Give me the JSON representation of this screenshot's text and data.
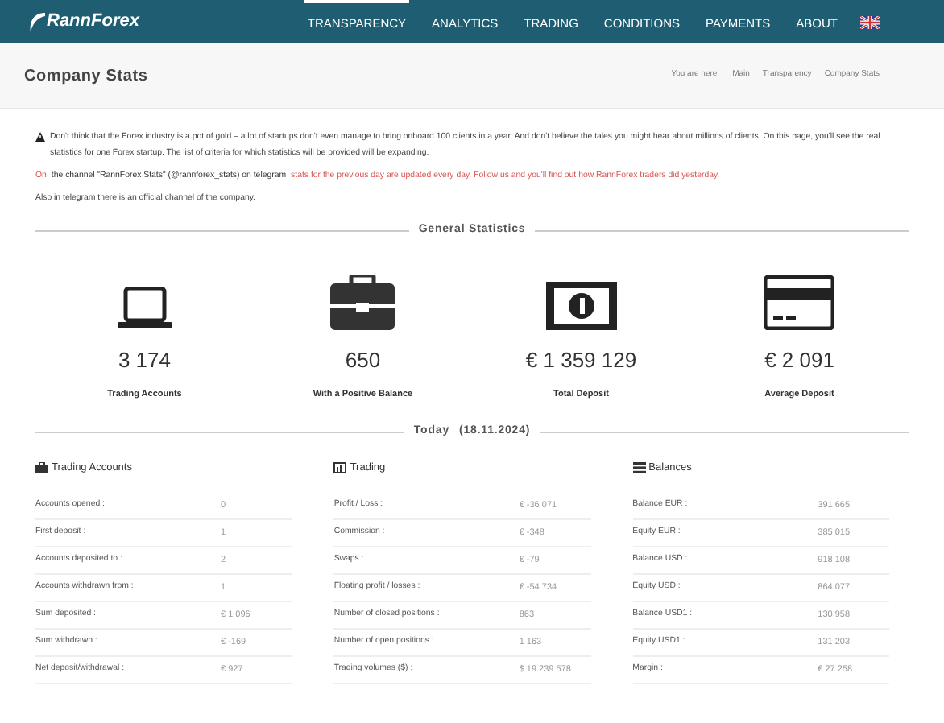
{
  "header": {
    "logo": "RannForex",
    "nav": [
      {
        "label": "TRANSPARENCY",
        "selected": true
      },
      {
        "label": "ANALYTICS",
        "selected": false
      },
      {
        "label": "TRADING",
        "selected": false
      },
      {
        "label": "CONDITIONS",
        "selected": false
      },
      {
        "label": "PAYMENTS",
        "selected": false
      },
      {
        "label": "ABOUT",
        "selected": false
      }
    ]
  },
  "page_title": "Company Stats",
  "breadcrumb": [
    "You are here:",
    "Main",
    "Transparency",
    "Company Stats"
  ],
  "intro": {
    "warning": "Don't think that the Forex industry is a pot of gold – a lot of startups don't even manage to bring onboard 100 clients in a year. And don't believe the tales you might hear about millions of clients. On this page, you'll see the real statistics for one Forex startup. The list of criteria for which statistics will be provided will be expanding.",
    "channel": [
      {
        "text": "On",
        "accent": true
      },
      {
        "text": "the channel \"RannForex Stats\" (@rannforex_stats) on telegram",
        "accent": false
      },
      {
        "text": "stats for the previous day are updated every day. Follow us and you'll find out how RannForex traders did yesterday.",
        "accent": true
      }
    ],
    "official": "Also in telegram there is an official channel of the company."
  },
  "general": {
    "title": "General Statistics",
    "stats": [
      {
        "kind": "laptop",
        "value": "3 174",
        "label": "Trading Accounts"
      },
      {
        "kind": "briefcase",
        "value": "650",
        "label": "With a Positive Balance"
      },
      {
        "kind": "banknote",
        "value": "€ 1 359 129",
        "label": "Total Deposit"
      },
      {
        "kind": "card",
        "value": "€ 2 091",
        "label": "Average Deposit"
      }
    ]
  },
  "today": {
    "title": "Today",
    "date": "(18.11.2024)"
  },
  "tables": [
    {
      "kind": "briefcase",
      "title": "Trading Accounts",
      "rows": [
        {
          "label": "Accounts opened :",
          "value": "0"
        },
        {
          "label": "First deposit :",
          "value": "1"
        },
        {
          "label": "Accounts deposited to :",
          "value": "2"
        },
        {
          "label": "Accounts withdrawn from :",
          "value": "1"
        },
        {
          "label": "Sum deposited :",
          "value": "€ 1 096"
        },
        {
          "label": "Sum withdrawn :",
          "value": "€ -169"
        },
        {
          "label": "Net deposit/withdrawal :",
          "value": "€ 927"
        }
      ]
    },
    {
      "kind": "chart",
      "title": "Trading",
      "rows": [
        {
          "label": "Profit / Loss :",
          "value": "€ -36 071"
        },
        {
          "label": "Commission :",
          "value": "€ -348"
        },
        {
          "label": "Swaps :",
          "value": "€ -79"
        },
        {
          "label": "Floating profit / losses :",
          "value": "€ -54 734"
        },
        {
          "label": "Number of closed positions :",
          "value": "863"
        },
        {
          "label": "Number of open positions :",
          "value": "1 163"
        },
        {
          "label": "Trading volumes ($) :",
          "value": "$ 19 239 578"
        }
      ]
    },
    {
      "kind": "list",
      "title": "Balances",
      "rows": [
        {
          "label": "Balance EUR :",
          "value": "391 665"
        },
        {
          "label": "Equity EUR :",
          "value": "385 015"
        },
        {
          "label": "Balance USD :",
          "value": "918 108"
        },
        {
          "label": "Equity USD :",
          "value": "864 077"
        },
        {
          "label": "Balance USD1 :",
          "value": "130 958"
        },
        {
          "label": "Equity USD1 :",
          "value": "131 203"
        },
        {
          "label": "Margin :",
          "value": "€ 27 258"
        }
      ]
    }
  ]
}
